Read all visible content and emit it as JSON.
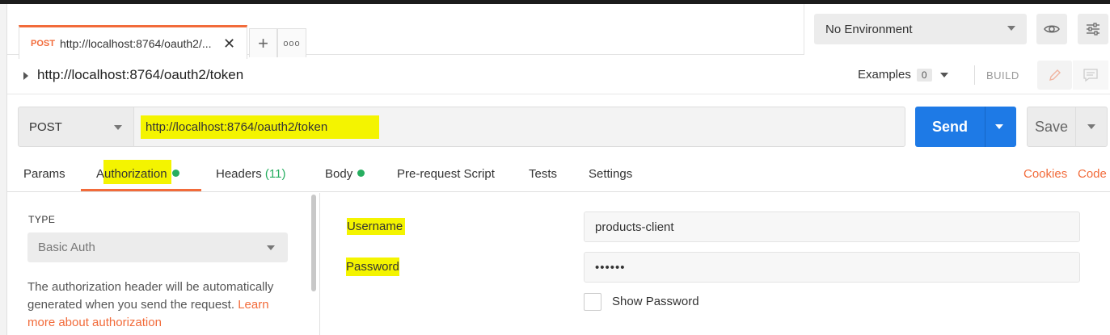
{
  "tab": {
    "method": "POST",
    "title": "http://localhost:8764/oauth2/...",
    "plus": "+",
    "more": "ooo"
  },
  "environment": {
    "selected": "No Environment"
  },
  "request": {
    "name": "http://localhost:8764/oauth2/token",
    "examples_label": "Examples",
    "examples_count": "0",
    "build_label": "BUILD"
  },
  "url_bar": {
    "method": "POST",
    "url": "http://localhost:8764/oauth2/token",
    "send_label": "Send",
    "save_label": "Save"
  },
  "request_tabs": {
    "params": "Params",
    "authorization": "Authorization",
    "headers": "Headers",
    "headers_count": "(11)",
    "body": "Body",
    "prerequest": "Pre-request Script",
    "tests": "Tests",
    "settings": "Settings",
    "cookies": "Cookies",
    "code": "Code"
  },
  "auth": {
    "type_label": "TYPE",
    "type_value": "Basic Auth",
    "description": "The authorization header will be automatically generated when you send the request.",
    "learn_more": "Learn more about authorization",
    "username_label": "Username",
    "username_value": "products-client",
    "password_label": "Password",
    "password_value": "••••••",
    "show_password_label": "Show Password"
  },
  "colors": {
    "accent": "#f26b3a",
    "send": "#1e7ae6",
    "highlight": "#f4f400",
    "status_dot": "#27ae60"
  }
}
